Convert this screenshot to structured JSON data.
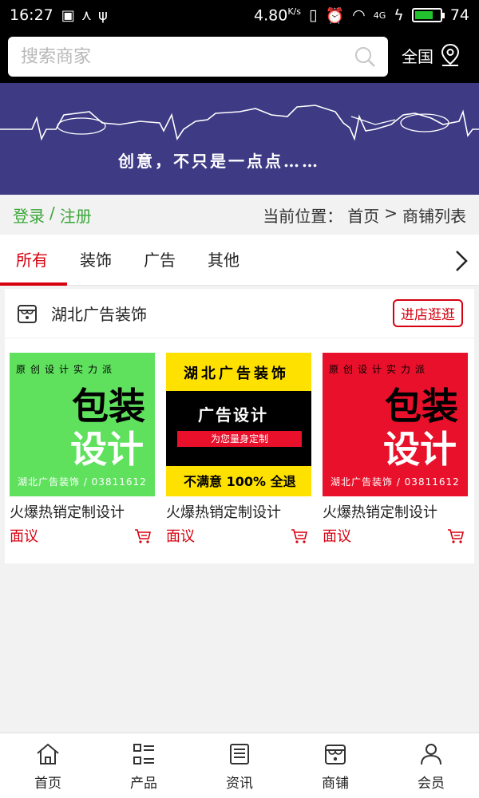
{
  "status_bar": {
    "time": "16:27",
    "speed": "4.80",
    "speed_unit": "K/s",
    "network": "4G",
    "battery": "74",
    "battery_level": 0.74
  },
  "search": {
    "placeholder": "搜索商家",
    "region_label": "全国"
  },
  "banner": {
    "slogan": "创意，不只是一点点……"
  },
  "crumbbar": {
    "login": "登录",
    "separator": "/",
    "register": "注册",
    "prefix": "当前位置：",
    "home": "首页",
    "arrow": ">",
    "current": "商铺列表"
  },
  "tabs": [
    {
      "label": "所有",
      "active": true
    },
    {
      "label": "装饰",
      "active": false
    },
    {
      "label": "广告",
      "active": false
    },
    {
      "label": "其他",
      "active": false
    }
  ],
  "shop": {
    "name": "湖北广告装饰",
    "visit_label": "进店逛逛",
    "products": [
      {
        "title": "火爆热销定制设计",
        "price": "面议",
        "art_line": "原创设计实力派",
        "art_big1": "包装",
        "art_big2": "设计",
        "art_foot": "湖北广告装饰 / 03811612"
      },
      {
        "title": "火爆热销定制设计",
        "price": "面议",
        "art_title": "湖北广告装饰",
        "art_band": "广告设计",
        "art_pill": "为您量身定制",
        "art_bottom": "不满意 100% 全退"
      },
      {
        "title": "火爆热销定制设计",
        "price": "面议",
        "art_line": "原创设计实力派",
        "art_big1": "包装",
        "art_big2": "设计",
        "art_foot": "湖北广告装饰 / 03811612"
      }
    ]
  },
  "bottom_nav": [
    {
      "label": "首页",
      "icon": "home-icon"
    },
    {
      "label": "产品",
      "icon": "list-icon"
    },
    {
      "label": "资讯",
      "icon": "news-icon"
    },
    {
      "label": "商铺",
      "icon": "shop-icon"
    },
    {
      "label": "会员",
      "icon": "user-icon"
    }
  ],
  "colors": {
    "accent": "#d7000f",
    "login_green": "#3aa63a",
    "banner_bg": "#3e3a84"
  }
}
